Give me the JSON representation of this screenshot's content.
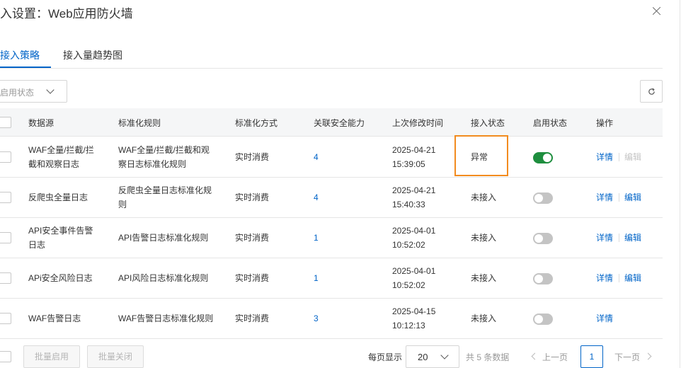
{
  "dialog": {
    "title": "入设置：Web应用防火墙"
  },
  "tabs": [
    {
      "label": "接入策略",
      "active": true
    },
    {
      "label": "接入量趋势图",
      "active": false
    }
  ],
  "filter": {
    "label": "启用状态"
  },
  "table": {
    "headers": [
      "数据源",
      "标准化规则",
      "标准化方式",
      "关联安全能力",
      "上次修改时间",
      "接入状态",
      "启用状态",
      "操作"
    ],
    "rows": [
      {
        "source": [
          "WAF全量/拦截/拦",
          "截和观察日志"
        ],
        "rule": [
          "WAF全量/拦截/拦截和观",
          "察日志标准化规则"
        ],
        "method": "实时消费",
        "capability": "4",
        "time": [
          "2025-04-21",
          "15:39:05"
        ],
        "access_status": "异常",
        "enabled": true,
        "detail": "详情",
        "edit": "编辑",
        "edit_disabled": true
      },
      {
        "source": [
          "反爬虫全量日志"
        ],
        "rule": [
          "反爬虫全量日志标准化规",
          "则"
        ],
        "method": "实时消费",
        "capability": "4",
        "time": [
          "2025-04-21",
          "15:40:33"
        ],
        "access_status": "未接入",
        "enabled": false,
        "detail": "详情",
        "edit": "编辑",
        "edit_disabled": false
      },
      {
        "source": [
          "API安全事件告警",
          "日志"
        ],
        "rule": [
          "API告警日志标准化规则"
        ],
        "method": "实时消费",
        "capability": "1",
        "time": [
          "2025-04-01",
          "10:52:02"
        ],
        "access_status": "未接入",
        "enabled": false,
        "detail": "详情",
        "edit": "编辑",
        "edit_disabled": false
      },
      {
        "source": [
          "APi安全风险日志"
        ],
        "rule": [
          "API风险日志标准化规则"
        ],
        "method": "实时消费",
        "capability": "1",
        "time": [
          "2025-04-01",
          "10:52:02"
        ],
        "access_status": "未接入",
        "enabled": false,
        "detail": "详情",
        "edit": "编辑",
        "edit_disabled": false
      },
      {
        "source": [
          "WAF告警日志"
        ],
        "rule": [
          "WAF告警日志标准化规则"
        ],
        "method": "实时消费",
        "capability": "3",
        "time": [
          "2025-04-15",
          "10:12:13"
        ],
        "access_status": "未接入",
        "enabled": false,
        "detail": "详情",
        "edit": "",
        "edit_disabled": false
      }
    ]
  },
  "footer": {
    "batch_enable": "批量启用",
    "batch_disable": "批量关闭",
    "page_size_label": "每页显示",
    "page_size": "20",
    "total": "共 5 条数据",
    "prev": "上一页",
    "current_page": "1",
    "next": "下一页"
  },
  "colors": {
    "primary": "#0064c8",
    "switch_on": "#1e8e3e",
    "highlight_border": "#f28b1f"
  },
  "icons": {
    "close": "close-icon",
    "refresh": "refresh-icon",
    "dropdown": "chevron-down-icon",
    "prev": "chevron-left-icon",
    "next": "chevron-right-icon"
  }
}
